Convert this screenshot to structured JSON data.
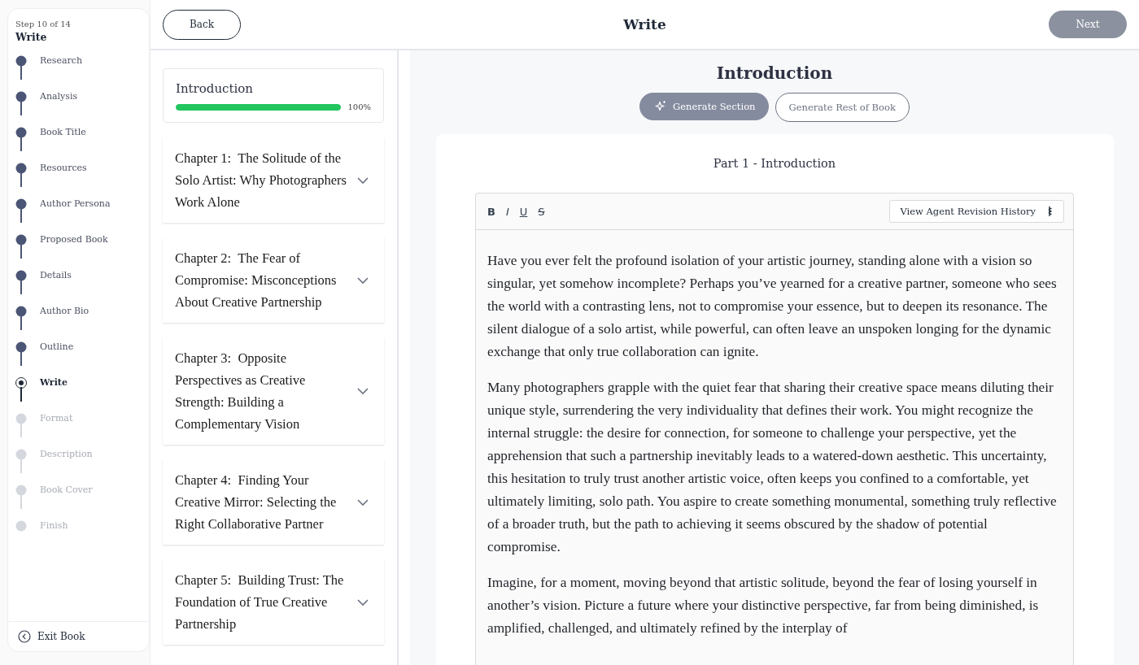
{
  "sidebar": {
    "step_counter": "Step 10 of 14",
    "current_title": "Write",
    "steps": [
      {
        "label": "Research",
        "completed": true,
        "selected": false
      },
      {
        "label": "Analysis",
        "completed": true,
        "selected": false
      },
      {
        "label": "Book Title",
        "completed": true,
        "selected": false
      },
      {
        "label": "Resources",
        "completed": true,
        "selected": false
      },
      {
        "label": "Author Persona",
        "completed": true,
        "selected": false
      },
      {
        "label": "Proposed Book",
        "completed": true,
        "selected": false
      },
      {
        "label": "Details",
        "completed": true,
        "selected": false
      },
      {
        "label": "Author Bio",
        "completed": true,
        "selected": false
      },
      {
        "label": "Outline",
        "completed": true,
        "selected": false
      },
      {
        "label": "Write",
        "completed": false,
        "selected": true
      },
      {
        "label": "Format",
        "completed": false,
        "selected": false
      },
      {
        "label": "Description",
        "completed": false,
        "selected": false
      },
      {
        "label": "Book Cover",
        "completed": false,
        "selected": false
      },
      {
        "label": "Finish",
        "completed": false,
        "selected": false
      }
    ],
    "exit_label": "Exit Book"
  },
  "header": {
    "back_label": "Back",
    "title": "Write",
    "next_label": "Next"
  },
  "sections": {
    "introduction": {
      "title": "Introduction",
      "level": 1,
      "percent": "100%"
    },
    "chapters": [
      {
        "title": "Chapter 1:  The Solitude of the Solo Artist: Why Photographers Work Alone",
        "expanded": false
      },
      {
        "title": "Chapter 2:  The Fear of Compromise: Misconceptions About Creative Partnership",
        "expanded": false
      },
      {
        "title": "Chapter 3:  Opposite Perspectives as Creative Strength: Building a Complementary Vision",
        "expanded": false
      },
      {
        "title": "Chapter 4:  Finding Your Creative Mirror: Selecting the Right Collaborative Partner",
        "expanded": false
      },
      {
        "title": "Chapter 5:  Building Trust: The Foundation of True Creative Partnership",
        "expanded": false
      }
    ]
  },
  "main": {
    "title": "Introduction",
    "generate_section_label": "Generate Section",
    "generate_rest_label": "Generate Rest of Book",
    "part_title": "Part 1 - Introduction",
    "toolbar": {
      "formats": [
        {
          "kind": "bold",
          "glyph": "B"
        },
        {
          "kind": "italic",
          "glyph": "I"
        },
        {
          "kind": "underline",
          "glyph": "U"
        },
        {
          "kind": "strike",
          "glyph": "S"
        }
      ],
      "history_label": "View Agent Revision History"
    },
    "paragraphs": [
      "Have you ever felt the profound isolation of your artistic journey, standing alone with a vision so singular, yet somehow incomplete? Perhaps you’ve yearned for a creative partner, someone who sees the world with a contrasting lens, not to compromise your essence, but to deepen its resonance. The silent dialogue of a solo artist, while powerful, can often leave an unspoken longing for the dynamic exchange that only true collaboration can ignite.",
      "Many photographers grapple with the quiet fear that sharing their creative space means diluting their unique style, surrendering the very individuality that defines their work. You might recognize the internal struggle: the desire for connection, for someone to challenge your perspective, yet the apprehension that such a partnership inevitably leads to a watered-down aesthetic. This uncertainty, this hesitation to truly trust another artistic voice, often keeps you confined to a comfortable, yet ultimately limiting, solo path. You aspire to create something monumental, something truly reflective of a broader truth, but the path to achieving it seems obscured by the shadow of potential compromise.",
      "Imagine, for a moment, moving beyond that artistic solitude, beyond the fear of losing yourself in another’s vision. Picture a future where your distinctive perspective, far from being diminished, is amplified, challenged, and ultimately refined by the interplay of"
    ]
  }
}
